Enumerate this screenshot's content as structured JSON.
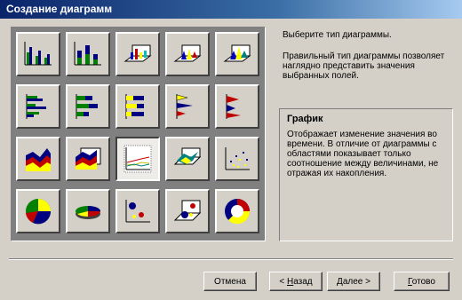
{
  "window": {
    "title": "Создание диаграмм"
  },
  "chart_types": [
    {
      "name": "column-clustered-icon"
    },
    {
      "name": "column-stacked-icon"
    },
    {
      "name": "column-3d-icon"
    },
    {
      "name": "column-3d-cone-icon"
    },
    {
      "name": "column-3d-pyramid-icon"
    },
    {
      "name": "bar-clustered-icon"
    },
    {
      "name": "bar-stacked-icon"
    },
    {
      "name": "bar-stacked-100-icon"
    },
    {
      "name": "bar-cone-icon"
    },
    {
      "name": "bar-pyramid-icon"
    },
    {
      "name": "area-icon"
    },
    {
      "name": "area-3d-icon"
    },
    {
      "name": "line-icon",
      "selected": true
    },
    {
      "name": "surface-3d-icon"
    },
    {
      "name": "scatter-icon"
    },
    {
      "name": "pie-icon"
    },
    {
      "name": "pie-3d-icon"
    },
    {
      "name": "bubble-icon"
    },
    {
      "name": "bubble-3d-icon"
    },
    {
      "name": "doughnut-icon"
    }
  ],
  "info": {
    "line1": "Выберите тип диаграммы.",
    "line2": "Правильный тип диаграммы позволяет наглядно представить значения выбранных полей."
  },
  "description": {
    "title": "График",
    "text": "Отображает изменение значения во времени. В отличие от диаграммы с областями показывает только соотношение между величинами, не отражая их накопления."
  },
  "buttons": {
    "cancel": "Отмена",
    "back_prefix": "< ",
    "back_key": "Н",
    "back_rest": "азад",
    "next_key": "Д",
    "next_rest": "алее >",
    "finish_key": "Г",
    "finish_rest": "отово"
  },
  "colors": {
    "title_start": "#0a246a",
    "title_end": "#a6caf0",
    "face": "#d4d0c8"
  }
}
